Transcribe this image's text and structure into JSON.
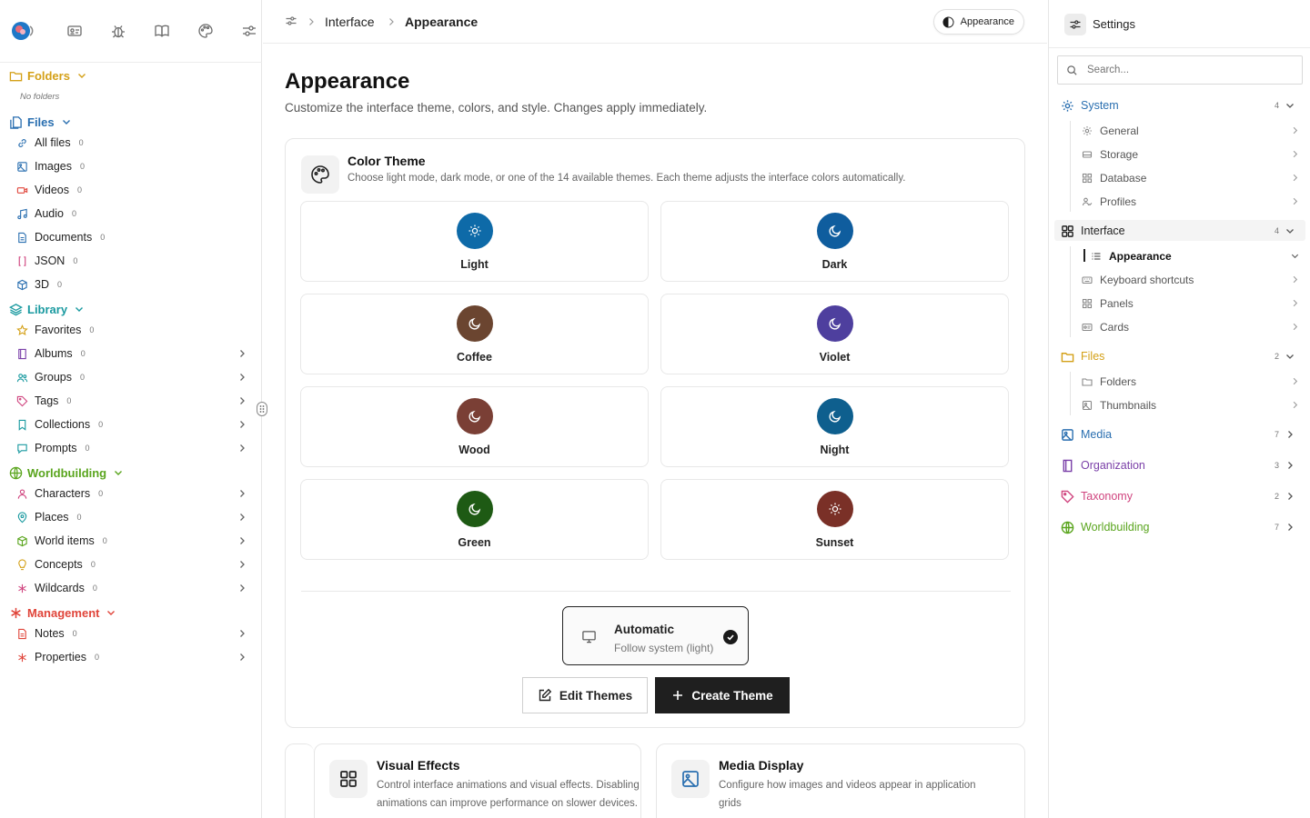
{
  "left": {
    "folders": {
      "label": "Folders",
      "color": "#d4a017",
      "empty_note": "No folders"
    },
    "files": {
      "label": "Files",
      "color": "#2a6fb0",
      "items": [
        {
          "label": "All files",
          "count": "0",
          "icon": "link-icon"
        },
        {
          "label": "Images",
          "count": "0",
          "icon": "image-icon"
        },
        {
          "label": "Videos",
          "count": "0",
          "icon": "video-icon"
        },
        {
          "label": "Audio",
          "count": "0",
          "icon": "music-icon"
        },
        {
          "label": "Documents",
          "count": "0",
          "icon": "document-icon"
        },
        {
          "label": "JSON",
          "count": "0",
          "icon": "braces-icon"
        },
        {
          "label": "3D",
          "count": "0",
          "icon": "cube-icon"
        }
      ]
    },
    "library": {
      "label": "Library",
      "color": "#1a9aa0",
      "items": [
        {
          "label": "Favorites",
          "count": "0",
          "icon": "star-icon"
        },
        {
          "label": "Albums",
          "count": "0",
          "icon": "album-icon"
        },
        {
          "label": "Groups",
          "count": "0",
          "icon": "users-icon"
        },
        {
          "label": "Tags",
          "count": "0",
          "icon": "tag-icon"
        },
        {
          "label": "Collections",
          "count": "0",
          "icon": "bookmark-icon"
        },
        {
          "label": "Prompts",
          "count": "0",
          "icon": "message-icon"
        }
      ]
    },
    "worldbuilding": {
      "label": "Worldbuilding",
      "color": "#5aa51e",
      "items": [
        {
          "label": "Characters",
          "count": "0",
          "icon": "person-icon"
        },
        {
          "label": "Places",
          "count": "0",
          "icon": "pin-icon"
        },
        {
          "label": "World items",
          "count": "0",
          "icon": "box-icon"
        },
        {
          "label": "Concepts",
          "count": "0",
          "icon": "bulb-icon"
        },
        {
          "label": "Wildcards",
          "count": "0",
          "icon": "asterisk-icon"
        }
      ]
    },
    "management": {
      "label": "Management",
      "color": "#e0453a",
      "items": [
        {
          "label": "Notes",
          "count": "0",
          "icon": "note-icon"
        },
        {
          "label": "Properties",
          "count": "0",
          "icon": "asterisk-icon"
        }
      ]
    }
  },
  "breadcrumb": {
    "parent": "Interface",
    "current": "Appearance"
  },
  "pill_label": "Appearance",
  "page": {
    "title": "Appearance",
    "description": "Customize the interface theme, colors, and style. Changes apply immediately."
  },
  "color_theme": {
    "title": "Color Theme",
    "description": "Choose light mode, dark mode, or one of the 14 available themes. Each theme adjusts the interface colors automatically.",
    "themes": [
      {
        "label": "Light",
        "color": "#0e6aa8",
        "icon": "sun"
      },
      {
        "label": "Dark",
        "color": "#0f5d9e",
        "icon": "moon"
      },
      {
        "label": "Coffee",
        "color": "#6b4530",
        "icon": "moon"
      },
      {
        "label": "Violet",
        "color": "#4e3f9e",
        "icon": "moon"
      },
      {
        "label": "Wood",
        "color": "#7a3f35",
        "icon": "moon"
      },
      {
        "label": "Night",
        "color": "#0e5f8e",
        "icon": "moon"
      },
      {
        "label": "Green",
        "color": "#1e5a14",
        "icon": "moon"
      },
      {
        "label": "Sunset",
        "color": "#7a3027",
        "icon": "sun"
      }
    ],
    "automatic": {
      "title": "Automatic",
      "subtitle": "Follow system (light)"
    },
    "edit_label": "Edit Themes",
    "create_label": "Create Theme"
  },
  "visual_effects": {
    "title": "Visual Effects",
    "description": "Control interface animations and visual effects. Disabling animations can improve performance on slower devices."
  },
  "media_display": {
    "title": "Media Display",
    "description": "Configure how images and videos appear in application grids"
  },
  "right": {
    "title": "Settings",
    "search_placeholder": "Search...",
    "system": {
      "label": "System",
      "count": "4",
      "color": "#2a6fb0",
      "items": [
        "General",
        "Storage",
        "Database",
        "Profiles"
      ]
    },
    "interface": {
      "label": "Interface",
      "count": "4",
      "color": "#222222",
      "items": [
        "Appearance",
        "Keyboard shortcuts",
        "Panels",
        "Cards"
      ]
    },
    "files": {
      "label": "Files",
      "count": "2",
      "color": "#d4a017",
      "items": [
        "Folders",
        "Thumbnails"
      ]
    },
    "media": {
      "label": "Media",
      "count": "7",
      "color": "#2a6fb0"
    },
    "organization": {
      "label": "Organization",
      "count": "3",
      "color": "#7a3fa8"
    },
    "taxonomy": {
      "label": "Taxonomy",
      "count": "2",
      "color": "#d0457f"
    },
    "worldbuilding": {
      "label": "Worldbuilding",
      "count": "7",
      "color": "#5aa51e"
    }
  }
}
